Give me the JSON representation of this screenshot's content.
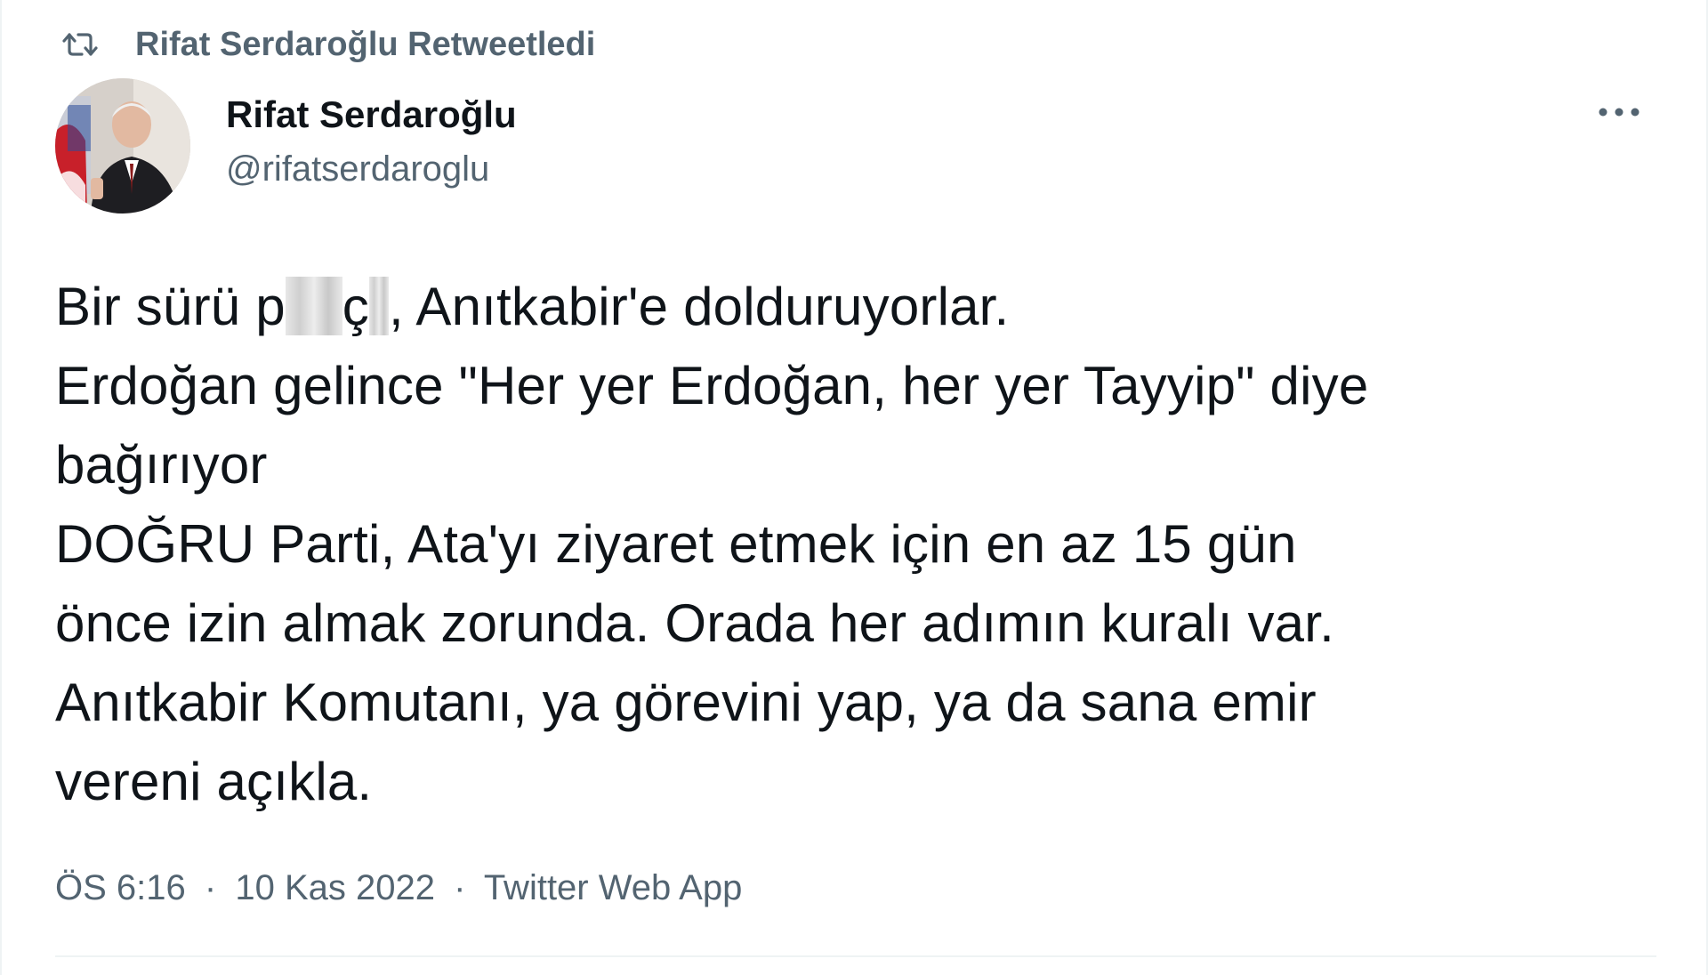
{
  "retweet": {
    "icon": "retweet-icon",
    "label": "Rifat Serdaroğlu Retweetledi"
  },
  "author": {
    "display_name": "Rifat Serdaroğlu",
    "handle": "@rifatserdaroglu",
    "avatar": "profile-photo"
  },
  "more_icon": "more-options-icon",
  "tweet": {
    "line1_before": "Bir sürü p",
    "line1_mid": "ç",
    "line1_after": ", Anıtkabir'e dolduruyorlar.",
    "lines": [
      "Erdoğan gelince \"Her yer Erdoğan, her yer Tayyip\" diye",
      "bağırıyor",
      "DOĞRU Parti, Ata'yı ziyaret etmek için en az 15 gün",
      "önce izin almak zorunda. Orada her adımın kuralı var.",
      "Anıtkabir Komutanı, ya görevini yap, ya da sana emir",
      "vereni açıkla."
    ]
  },
  "meta": {
    "time": "ÖS 6:16",
    "separator": "·",
    "date": "10 Kas 2022",
    "source": "Twitter Web App"
  },
  "colors": {
    "text_primary": "#0f1419",
    "text_secondary": "#536471",
    "divider": "#eff3f4"
  }
}
